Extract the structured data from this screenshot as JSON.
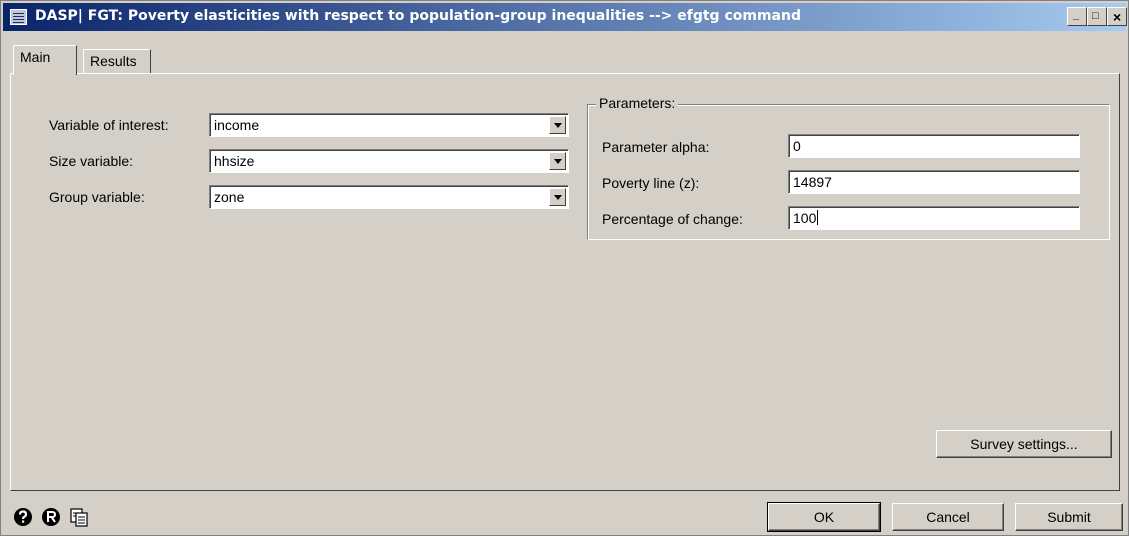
{
  "window": {
    "title": "DASP| FGT: Poverty elasticities with respect to population-group inequalities --> efgtg command"
  },
  "titlebar_buttons": {
    "minimize": "_",
    "maximize": "□",
    "close": "×"
  },
  "tabs": [
    {
      "label": "Main",
      "active": true
    },
    {
      "label": "Results",
      "active": false
    }
  ],
  "main": {
    "variable_of_interest": {
      "label": "Variable of interest:",
      "value": "income"
    },
    "size_variable": {
      "label": "Size  variable:",
      "value": "hhsize"
    },
    "group_variable": {
      "label": "Group  variable:",
      "value": "zone"
    }
  },
  "parameters": {
    "title": "Parameters:",
    "alpha": {
      "label": "Parameter alpha:",
      "value": "0"
    },
    "poverty_line": {
      "label": "Poverty line (z):",
      "value": "14897"
    },
    "percentage_change": {
      "label": "Percentage of change:",
      "value": "100"
    }
  },
  "buttons": {
    "survey_settings": "Survey settings...",
    "ok": "OK",
    "cancel": "Cancel",
    "submit": "Submit"
  },
  "bottom_icons": [
    "help-icon",
    "r-icon",
    "copy-icon"
  ],
  "colors": {
    "titlebar_start": "#0a246a",
    "titlebar_end": "#a6caf0",
    "face": "#d4d0c8"
  }
}
